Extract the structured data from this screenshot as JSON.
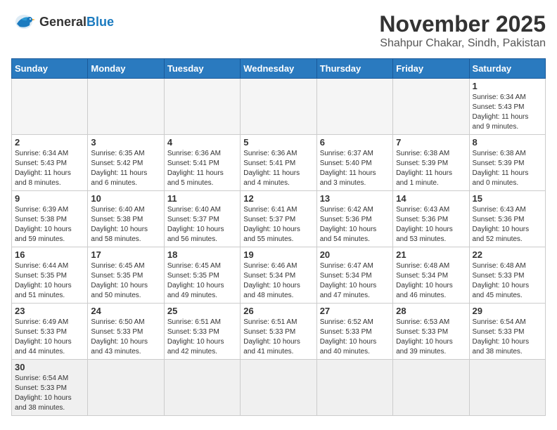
{
  "logo": {
    "text_general": "General",
    "text_blue": "Blue"
  },
  "header": {
    "month_year": "November 2025",
    "location": "Shahpur Chakar, Sindh, Pakistan"
  },
  "weekdays": [
    "Sunday",
    "Monday",
    "Tuesday",
    "Wednesday",
    "Thursday",
    "Friday",
    "Saturday"
  ],
  "days": [
    {
      "num": "",
      "info": ""
    },
    {
      "num": "",
      "info": ""
    },
    {
      "num": "",
      "info": ""
    },
    {
      "num": "",
      "info": ""
    },
    {
      "num": "",
      "info": ""
    },
    {
      "num": "",
      "info": ""
    },
    {
      "num": "1",
      "info": "Sunrise: 6:34 AM\nSunset: 5:43 PM\nDaylight: 11 hours\nand 9 minutes."
    },
    {
      "num": "2",
      "info": "Sunrise: 6:34 AM\nSunset: 5:43 PM\nDaylight: 11 hours\nand 8 minutes."
    },
    {
      "num": "3",
      "info": "Sunrise: 6:35 AM\nSunset: 5:42 PM\nDaylight: 11 hours\nand 6 minutes."
    },
    {
      "num": "4",
      "info": "Sunrise: 6:36 AM\nSunset: 5:41 PM\nDaylight: 11 hours\nand 5 minutes."
    },
    {
      "num": "5",
      "info": "Sunrise: 6:36 AM\nSunset: 5:41 PM\nDaylight: 11 hours\nand 4 minutes."
    },
    {
      "num": "6",
      "info": "Sunrise: 6:37 AM\nSunset: 5:40 PM\nDaylight: 11 hours\nand 3 minutes."
    },
    {
      "num": "7",
      "info": "Sunrise: 6:38 AM\nSunset: 5:39 PM\nDaylight: 11 hours\nand 1 minute."
    },
    {
      "num": "8",
      "info": "Sunrise: 6:38 AM\nSunset: 5:39 PM\nDaylight: 11 hours\nand 0 minutes."
    },
    {
      "num": "9",
      "info": "Sunrise: 6:39 AM\nSunset: 5:38 PM\nDaylight: 10 hours\nand 59 minutes."
    },
    {
      "num": "10",
      "info": "Sunrise: 6:40 AM\nSunset: 5:38 PM\nDaylight: 10 hours\nand 58 minutes."
    },
    {
      "num": "11",
      "info": "Sunrise: 6:40 AM\nSunset: 5:37 PM\nDaylight: 10 hours\nand 56 minutes."
    },
    {
      "num": "12",
      "info": "Sunrise: 6:41 AM\nSunset: 5:37 PM\nDaylight: 10 hours\nand 55 minutes."
    },
    {
      "num": "13",
      "info": "Sunrise: 6:42 AM\nSunset: 5:36 PM\nDaylight: 10 hours\nand 54 minutes."
    },
    {
      "num": "14",
      "info": "Sunrise: 6:43 AM\nSunset: 5:36 PM\nDaylight: 10 hours\nand 53 minutes."
    },
    {
      "num": "15",
      "info": "Sunrise: 6:43 AM\nSunset: 5:36 PM\nDaylight: 10 hours\nand 52 minutes."
    },
    {
      "num": "16",
      "info": "Sunrise: 6:44 AM\nSunset: 5:35 PM\nDaylight: 10 hours\nand 51 minutes."
    },
    {
      "num": "17",
      "info": "Sunrise: 6:45 AM\nSunset: 5:35 PM\nDaylight: 10 hours\nand 50 minutes."
    },
    {
      "num": "18",
      "info": "Sunrise: 6:45 AM\nSunset: 5:35 PM\nDaylight: 10 hours\nand 49 minutes."
    },
    {
      "num": "19",
      "info": "Sunrise: 6:46 AM\nSunset: 5:34 PM\nDaylight: 10 hours\nand 48 minutes."
    },
    {
      "num": "20",
      "info": "Sunrise: 6:47 AM\nSunset: 5:34 PM\nDaylight: 10 hours\nand 47 minutes."
    },
    {
      "num": "21",
      "info": "Sunrise: 6:48 AM\nSunset: 5:34 PM\nDaylight: 10 hours\nand 46 minutes."
    },
    {
      "num": "22",
      "info": "Sunrise: 6:48 AM\nSunset: 5:33 PM\nDaylight: 10 hours\nand 45 minutes."
    },
    {
      "num": "23",
      "info": "Sunrise: 6:49 AM\nSunset: 5:33 PM\nDaylight: 10 hours\nand 44 minutes."
    },
    {
      "num": "24",
      "info": "Sunrise: 6:50 AM\nSunset: 5:33 PM\nDaylight: 10 hours\nand 43 minutes."
    },
    {
      "num": "25",
      "info": "Sunrise: 6:51 AM\nSunset: 5:33 PM\nDaylight: 10 hours\nand 42 minutes."
    },
    {
      "num": "26",
      "info": "Sunrise: 6:51 AM\nSunset: 5:33 PM\nDaylight: 10 hours\nand 41 minutes."
    },
    {
      "num": "27",
      "info": "Sunrise: 6:52 AM\nSunset: 5:33 PM\nDaylight: 10 hours\nand 40 minutes."
    },
    {
      "num": "28",
      "info": "Sunrise: 6:53 AM\nSunset: 5:33 PM\nDaylight: 10 hours\nand 39 minutes."
    },
    {
      "num": "29",
      "info": "Sunrise: 6:54 AM\nSunset: 5:33 PM\nDaylight: 10 hours\nand 38 minutes."
    },
    {
      "num": "30",
      "info": "Sunrise: 6:54 AM\nSunset: 5:33 PM\nDaylight: 10 hours\nand 38 minutes."
    },
    {
      "num": "",
      "info": ""
    },
    {
      "num": "",
      "info": ""
    },
    {
      "num": "",
      "info": ""
    },
    {
      "num": "",
      "info": ""
    },
    {
      "num": "",
      "info": ""
    },
    {
      "num": "",
      "info": ""
    }
  ]
}
